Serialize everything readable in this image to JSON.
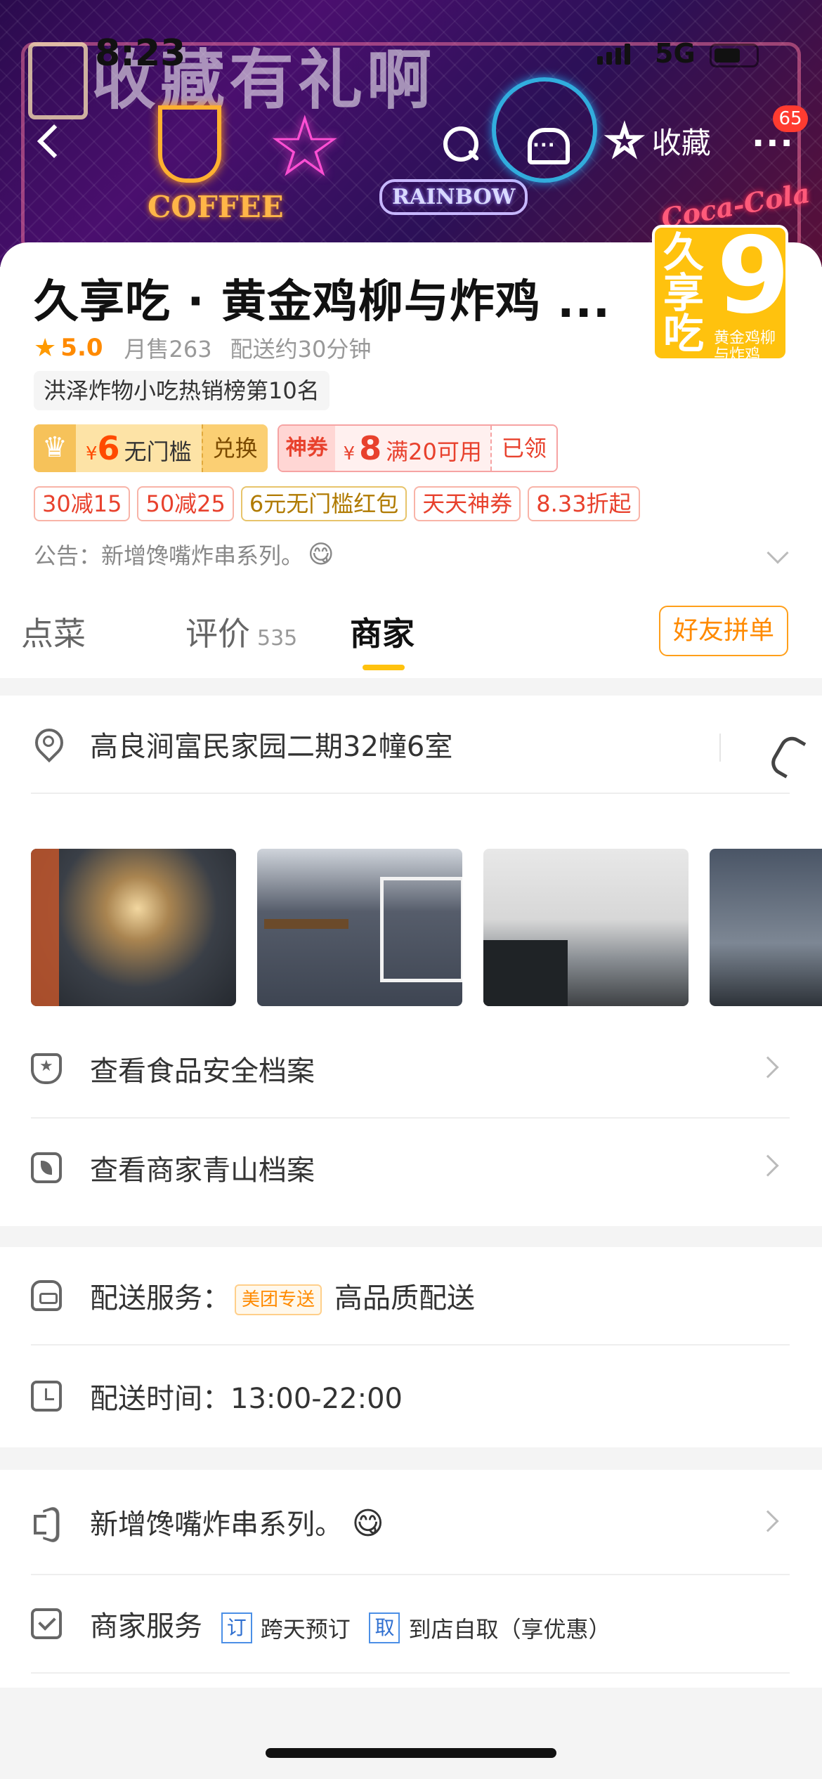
{
  "status_bar": {
    "time": "8:23",
    "network": "5G"
  },
  "banner": {
    "title": "收藏有礼啊",
    "neon_coffee": "COFFEE",
    "neon_rainbow": "RAINBOW",
    "neon_coca": "Coca-Cola"
  },
  "nav": {
    "favorite_label": "收藏",
    "message_count": "65"
  },
  "store": {
    "name": "久享吃 · 黄金鸡柳与炸鸡 ...",
    "rating": "5.0",
    "monthly_sales": "月售263",
    "delivery_time": "配送约30分钟",
    "rank": "洪泽炸物小吃热销榜第10名",
    "logo": {
      "chars": "久享吃",
      "nine": "9",
      "sub": "黄金鸡柳与炸鸡"
    }
  },
  "coupons": {
    "vip": {
      "currency": "¥",
      "amount": "6",
      "label": "无门槛",
      "action": "兑换"
    },
    "god": {
      "tag": "神券",
      "currency": "¥",
      "amount": "8",
      "label": "满20可用",
      "status": "已领"
    }
  },
  "promos": [
    "30减15",
    "50减25",
    "6元无门槛红包",
    "天天神券",
    "8.33折起"
  ],
  "notice": {
    "text": "公告：新增馋嘴炸串系列。",
    "emoji": "😋"
  },
  "tabs": {
    "order": "点菜",
    "review": "评价",
    "review_count": "535",
    "merchant": "商家",
    "group_button": "好友拼单"
  },
  "merchant": {
    "address": "高良涧富民家园二期32幢6室",
    "food_safety": "查看食品安全档案",
    "green_record": "查看商家青山档案",
    "delivery_service_label": "配送服务：",
    "delivery_badge": "美团专送",
    "delivery_quality": "高品质配送",
    "delivery_hours": "配送时间：13:00-22:00",
    "announcement": "新增馋嘴炸串系列。",
    "announcement_emoji": "😋",
    "services_label": "商家服务",
    "services": [
      {
        "icon": "订",
        "text": "跨天预订"
      },
      {
        "icon": "取",
        "text": "到店自取（享优惠）"
      }
    ]
  },
  "colors": {
    "brand_yellow": "#ffc20e",
    "accent_orange": "#ff8a00",
    "coupon_red": "#e8412d"
  }
}
